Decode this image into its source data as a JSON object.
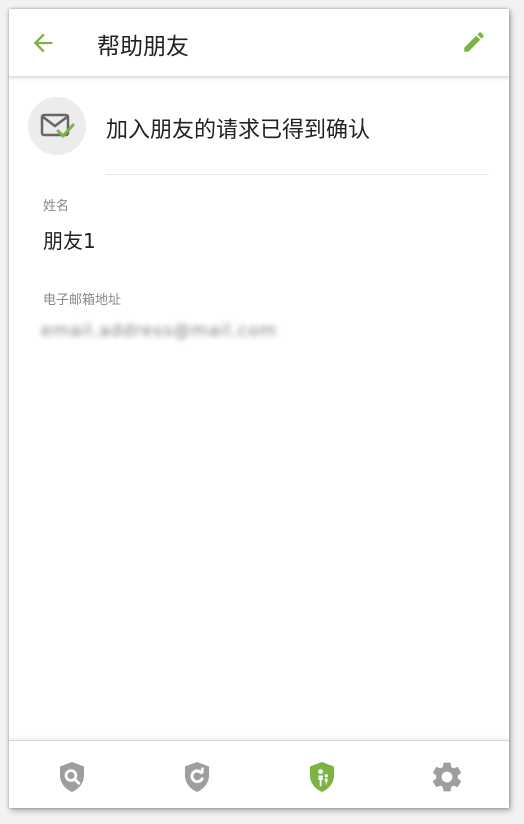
{
  "header": {
    "title": "帮助朋友",
    "back_icon": "arrow-back-icon",
    "edit_icon": "pencil-icon"
  },
  "status": {
    "icon": "mail-check-icon",
    "text": "加入朋友的请求已得到确认"
  },
  "fields": {
    "name_label": "姓名",
    "name_value": "朋友1",
    "email_label": "电子邮箱地址",
    "email_value": "email.address@mail.com"
  },
  "bottom_nav": [
    {
      "icon": "shield-search-icon",
      "active": false
    },
    {
      "icon": "shield-refresh-icon",
      "active": false
    },
    {
      "icon": "shield-family-icon",
      "active": true
    },
    {
      "icon": "gear-icon",
      "active": false
    }
  ],
  "colors": {
    "accent": "#7cb342",
    "inactive": "#9e9e9e",
    "text": "#222222"
  }
}
